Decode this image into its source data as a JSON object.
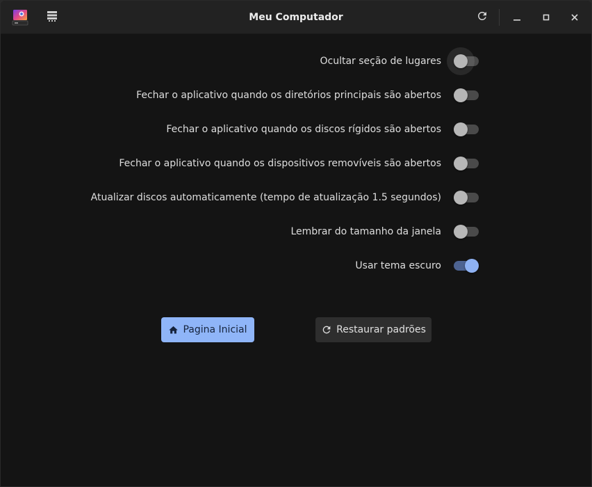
{
  "window": {
    "title": "Meu Computador"
  },
  "titlebar": {
    "app_icon": "app-logo-icon",
    "left_button_icon": "drives-list-icon",
    "refresh_icon": "refresh-icon",
    "minimize_icon": "minimize-icon",
    "maximize_icon": "maximize-icon",
    "close_icon": "close-icon"
  },
  "settings": [
    {
      "label": "Ocultar seção de lugares",
      "on": false
    },
    {
      "label": "Fechar o aplicativo quando os diretórios principais são abertos",
      "on": false
    },
    {
      "label": "Fechar o aplicativo quando os discos rígidos são abertos",
      "on": false
    },
    {
      "label": "Fechar o aplicativo quando os dispositivos removíveis são abertos",
      "on": false
    },
    {
      "label": "Atualizar discos automaticamente (tempo de atualização 1.5 segundos)",
      "on": false
    },
    {
      "label": "Lembrar do tamanho da janela",
      "on": false
    },
    {
      "label": "Usar tema escuro",
      "on": true
    }
  ],
  "buttons": {
    "home_label": "Pagina Inicial",
    "home_icon": "home-icon",
    "restore_label": "Restaurar padrões",
    "restore_icon": "restore-icon"
  },
  "colors": {
    "accent": "#8fb5f8",
    "background": "#141414",
    "titlebar": "#222222"
  }
}
